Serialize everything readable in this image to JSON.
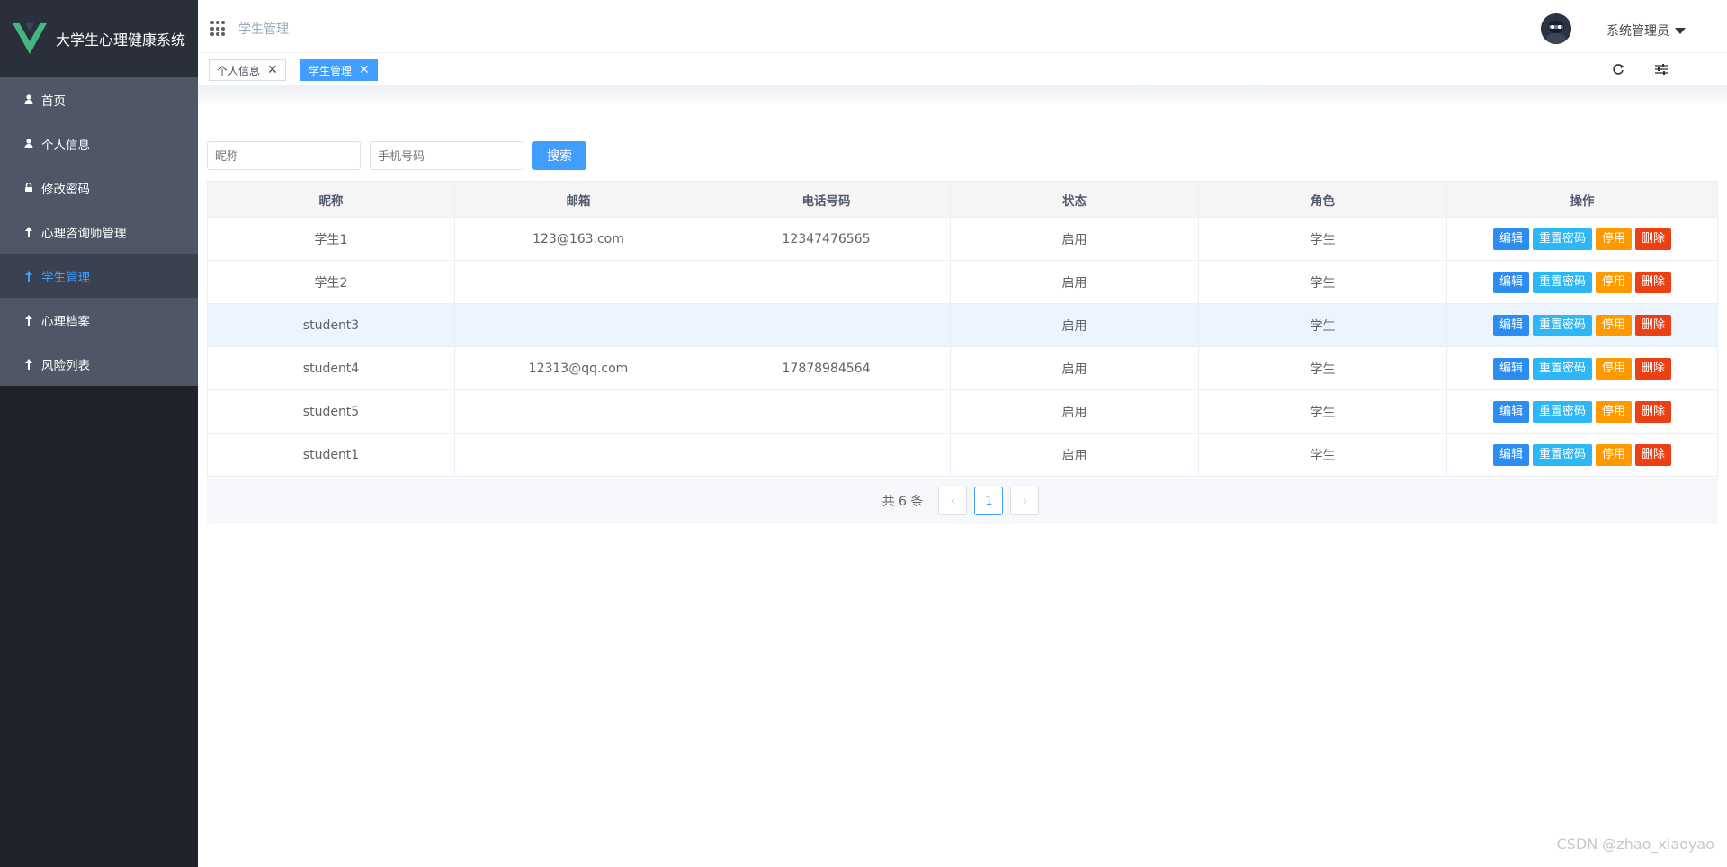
{
  "app": {
    "title": "大学生心理健康系统",
    "brand_color": "#41b883"
  },
  "sidebar": {
    "items": [
      {
        "label": "首页",
        "icon": "user-icon"
      },
      {
        "label": "个人信息",
        "icon": "user-icon"
      },
      {
        "label": "修改密码",
        "icon": "lock-icon"
      },
      {
        "label": "心理咨询师管理",
        "icon": "arrow-up-icon"
      },
      {
        "label": "学生管理",
        "icon": "arrow-up-icon",
        "active": true
      },
      {
        "label": "心理档案",
        "icon": "arrow-up-icon"
      },
      {
        "label": "风险列表",
        "icon": "arrow-up-icon"
      }
    ]
  },
  "header": {
    "breadcrumb": "学生管理",
    "user": "系统管理员"
  },
  "tags": [
    {
      "label": "个人信息",
      "active": false
    },
    {
      "label": "学生管理",
      "active": true
    }
  ],
  "search": {
    "nickname_placeholder": "昵称",
    "phone_placeholder": "手机号码",
    "button": "搜索"
  },
  "table": {
    "columns": [
      "昵称",
      "邮箱",
      "电话号码",
      "状态",
      "角色",
      "操作"
    ],
    "rows": [
      {
        "nickname": "学生1",
        "email": "123@163.com",
        "phone": "12347476565",
        "status": "启用",
        "role": "学生"
      },
      {
        "nickname": "学生2",
        "email": "",
        "phone": "",
        "status": "启用",
        "role": "学生"
      },
      {
        "nickname": "student3",
        "email": "",
        "phone": "",
        "status": "启用",
        "role": "学生"
      },
      {
        "nickname": "student4",
        "email": "12313@qq.com",
        "phone": "17878984564",
        "status": "启用",
        "role": "学生"
      },
      {
        "nickname": "student5",
        "email": "",
        "phone": "",
        "status": "启用",
        "role": "学生"
      },
      {
        "nickname": "student1",
        "email": "",
        "phone": "",
        "status": "启用",
        "role": "学生"
      }
    ],
    "actions": {
      "edit": "编辑",
      "reset": "重置密码",
      "disable": "停用",
      "delete": "删除"
    }
  },
  "pagination": {
    "total": "共 6 条",
    "current": "1",
    "prev": "‹",
    "next": "›"
  },
  "watermark": "CSDN @zhao_xiaoyao"
}
